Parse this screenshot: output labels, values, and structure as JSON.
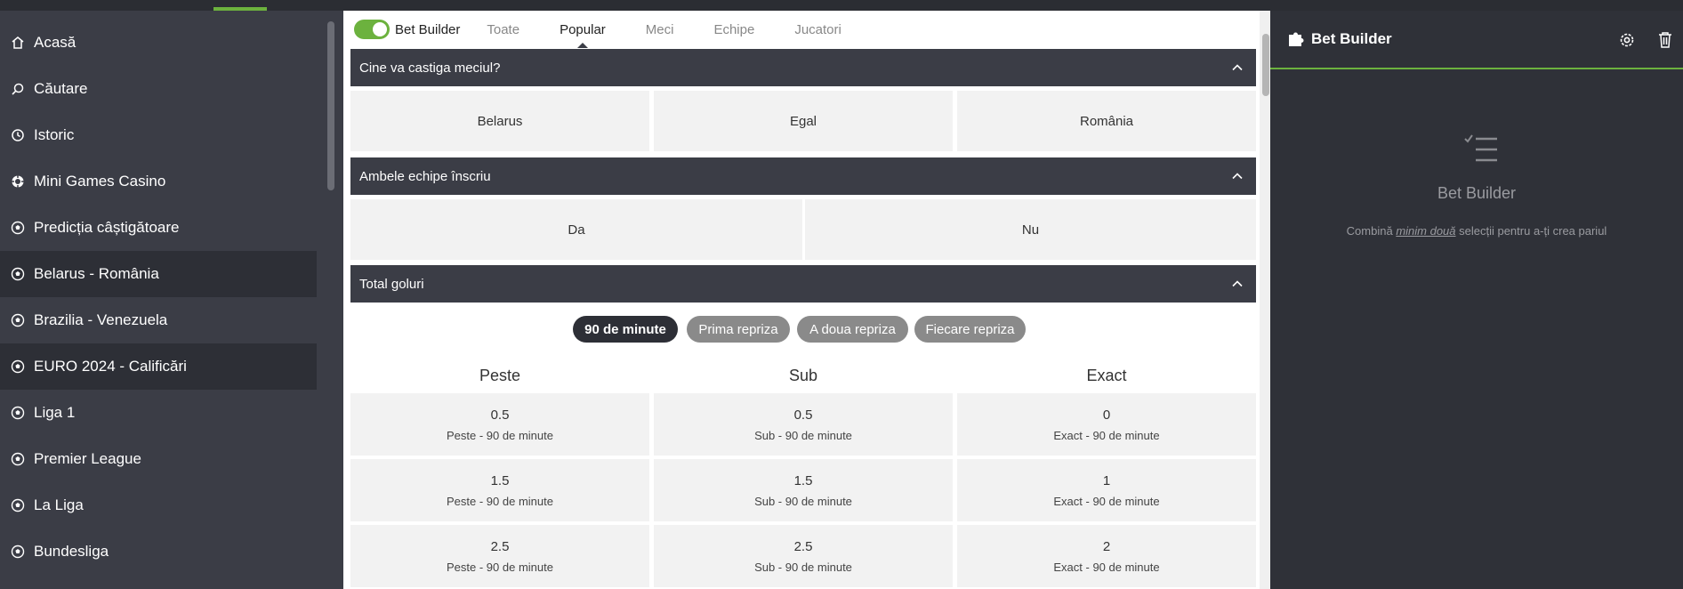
{
  "colors": {
    "accent": "#6cb23e",
    "sidebar_bg": "#3b3d46",
    "section_bg": "#3b3d46",
    "panel_bg": "#2f3138"
  },
  "sidebar": {
    "items": [
      {
        "label": "Acasă",
        "icon": "home-icon",
        "active": false
      },
      {
        "label": "Căutare",
        "icon": "search-icon",
        "active": false
      },
      {
        "label": "Istoric",
        "icon": "history-icon",
        "active": false
      },
      {
        "label": "Mini Games Casino",
        "icon": "casino-chip-icon",
        "active": false
      },
      {
        "label": "Predicția câștigătoare",
        "icon": "soccer-ball-icon",
        "active": false
      },
      {
        "label": "Belarus - România",
        "icon": "soccer-ball-icon",
        "active": true
      },
      {
        "label": "Brazilia - Venezuela",
        "icon": "soccer-ball-icon",
        "active": false
      },
      {
        "label": "EURO 2024 - Calificări",
        "icon": "soccer-ball-icon",
        "active": true
      },
      {
        "label": "Liga 1",
        "icon": "soccer-ball-icon",
        "active": false
      },
      {
        "label": "Premier League",
        "icon": "soccer-ball-icon",
        "active": false
      },
      {
        "label": "La Liga",
        "icon": "soccer-ball-icon",
        "active": false
      },
      {
        "label": "Bundesliga",
        "icon": "soccer-ball-icon",
        "active": false
      }
    ]
  },
  "tabs": {
    "toggle_label": "Bet Builder",
    "toggle_on": true,
    "items": [
      "Toate",
      "Popular",
      "Meci",
      "Echipe",
      "Jucatori"
    ],
    "active": "Popular"
  },
  "sections": {
    "winner": {
      "title": "Cine va castiga meciul?",
      "options": [
        "Belarus",
        "Egal",
        "România"
      ]
    },
    "both_score": {
      "title": "Ambele echipe înscriu",
      "options": [
        "Da",
        "Nu"
      ]
    },
    "total_goals": {
      "title": "Total goluri",
      "periods": [
        "90 de minute",
        "Prima repriza",
        "A doua repriza",
        "Fiecare repriza"
      ],
      "active_period": "90 de minute",
      "columns": [
        "Peste",
        "Sub",
        "Exact"
      ],
      "rows": [
        [
          {
            "value": "0.5",
            "sub": "Peste - 90 de minute"
          },
          {
            "value": "0.5",
            "sub": "Sub - 90 de minute"
          },
          {
            "value": "0",
            "sub": "Exact - 90 de minute"
          }
        ],
        [
          {
            "value": "1.5",
            "sub": "Peste - 90 de minute"
          },
          {
            "value": "1.5",
            "sub": "Sub - 90 de minute"
          },
          {
            "value": "1",
            "sub": "Exact - 90 de minute"
          }
        ],
        [
          {
            "value": "2.5",
            "sub": "Peste - 90 de minute"
          },
          {
            "value": "2.5",
            "sub": "Sub - 90 de minute"
          },
          {
            "value": "2",
            "sub": "Exact - 90 de minute"
          }
        ]
      ]
    }
  },
  "right_panel": {
    "title": "Bet Builder",
    "empty_title": "Bet Builder",
    "empty_text_before": "Combină ",
    "empty_text_em": "minim două",
    "empty_text_after": " selecții pentru a-ți crea pariul"
  }
}
